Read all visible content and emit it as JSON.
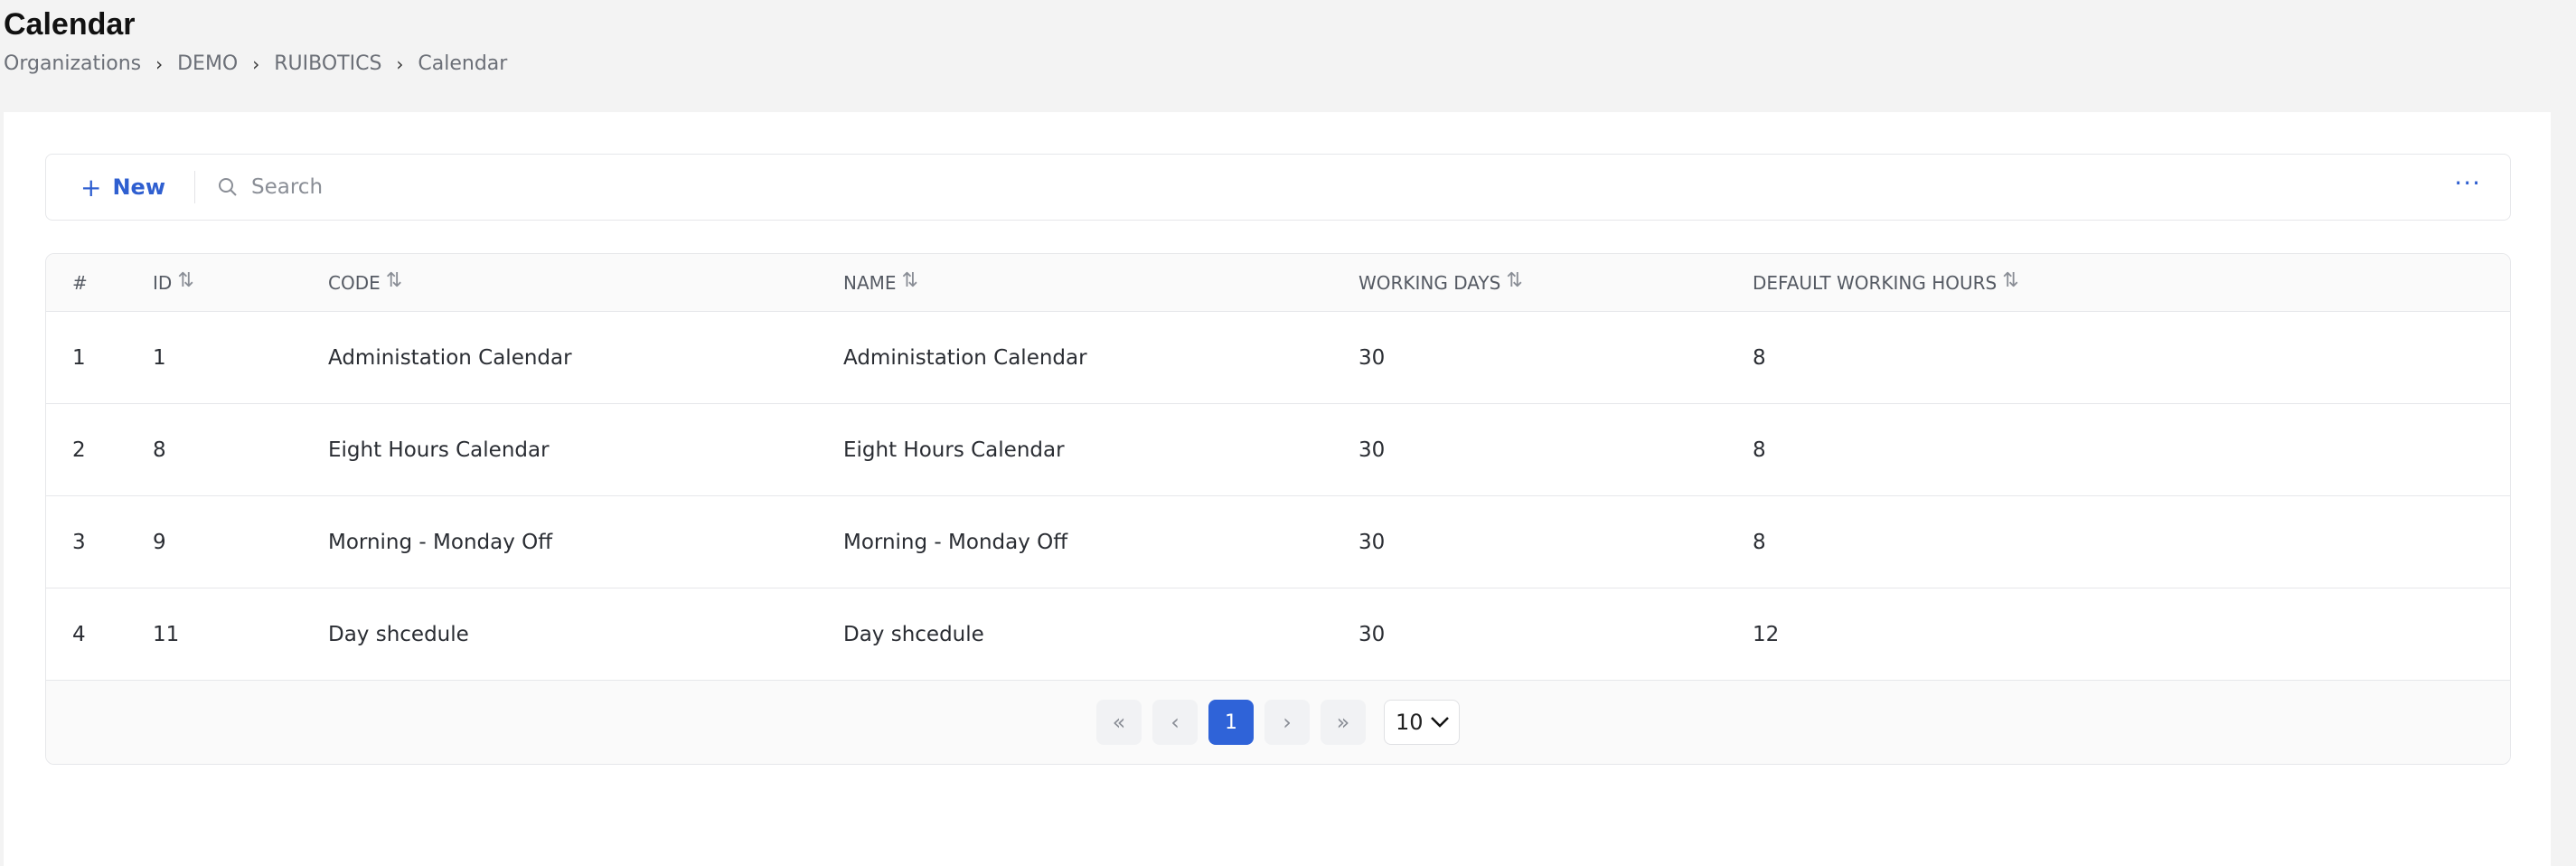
{
  "page": {
    "title": "Calendar",
    "breadcrumb": [
      "Organizations",
      "DEMO",
      "RUIBOTICS",
      "Calendar"
    ]
  },
  "toolbar": {
    "new_label": "New",
    "search_placeholder": "Search",
    "search_value": "",
    "more_label": "···"
  },
  "table": {
    "columns": [
      "#",
      "ID",
      "CODE",
      "NAME",
      "WORKING DAYS",
      "DEFAULT WORKING HOURS"
    ],
    "rows": [
      {
        "idx": "1",
        "id": "1",
        "code": "Administation Calendar",
        "name": "Administation Calendar",
        "working_days": "30",
        "default_working_hours": "8"
      },
      {
        "idx": "2",
        "id": "8",
        "code": "Eight Hours Calendar",
        "name": "Eight Hours Calendar",
        "working_days": "30",
        "default_working_hours": "8"
      },
      {
        "idx": "3",
        "id": "9",
        "code": "Morning - Monday Off",
        "name": "Morning - Monday Off",
        "working_days": "30",
        "default_working_hours": "8"
      },
      {
        "idx": "4",
        "id": "11",
        "code": "Day shcedule",
        "name": "Day shcedule",
        "working_days": "30",
        "default_working_hours": "12"
      }
    ]
  },
  "pagination": {
    "first_label": "«",
    "prev_label": "‹",
    "current_page": "1",
    "next_label": "›",
    "last_label": "»",
    "page_size": "10"
  },
  "colors": {
    "accent": "#2f63d8",
    "link": "#2f5fd0",
    "background": "#f3f3f3"
  }
}
